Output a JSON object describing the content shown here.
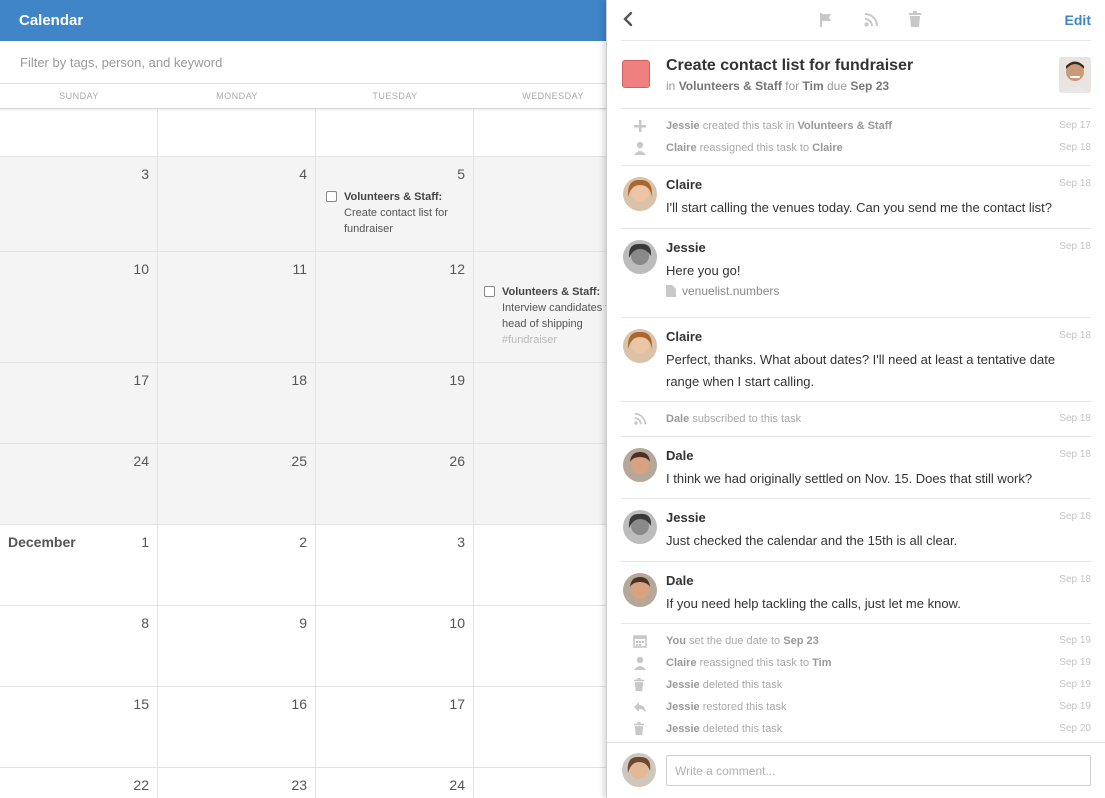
{
  "calendar": {
    "title": "Calendar",
    "filter_placeholder": "Filter by tags, person, and keyword",
    "weekdays": [
      "SUNDAY",
      "MONDAY",
      "TUESDAY",
      "WEDNESDAY"
    ],
    "weeks": [
      {
        "days": [
          "",
          "",
          "",
          ""
        ]
      },
      {
        "days": [
          "3",
          "4",
          "5",
          ""
        ]
      },
      {
        "days": [
          "10",
          "11",
          "12",
          ""
        ]
      },
      {
        "days": [
          "17",
          "18",
          "19",
          ""
        ]
      },
      {
        "days": [
          "24",
          "25",
          "26",
          ""
        ]
      },
      {
        "month": "December",
        "days": [
          "1",
          "2",
          "3",
          ""
        ]
      },
      {
        "days": [
          "8",
          "9",
          "10",
          ""
        ]
      },
      {
        "days": [
          "15",
          "16",
          "17",
          ""
        ]
      },
      {
        "days": [
          "22",
          "23",
          "24",
          ""
        ]
      }
    ],
    "tasks": {
      "t1": {
        "title": "Volunteers & Staff:",
        "text": "Create contact list for fundraiser"
      },
      "t2": {
        "title": "Volunteers & Staff:",
        "text": "Interview candidates for head of shipping",
        "tag": "#fundraiser"
      }
    }
  },
  "detail": {
    "edit_label": "Edit",
    "task_title": "Create contact list for fundraiser",
    "sub_in": "in",
    "sub_project": "Volunteers & Staff",
    "sub_for": "for",
    "sub_person": "Tim",
    "sub_due": "due",
    "sub_date": "Sep 23",
    "swatch_color": "#f08080",
    "accent_color": "#3f85c8",
    "feed": {
      "sys1": [
        {
          "icon": "plus-icon",
          "actor": "Jessie",
          "text": "created this task in",
          "obj": "Volunteers & Staff",
          "date": "Sep 17"
        },
        {
          "icon": "person-icon",
          "actor": "Claire",
          "text": "reassigned this task to",
          "obj": "Claire",
          "date": "Sep 18"
        }
      ],
      "c1": {
        "name": "Claire",
        "date": "Sep 18",
        "body": "I'll start calling the venues today. Can you send me the contact list?"
      },
      "c2": {
        "name": "Jessie",
        "date": "Sep 18",
        "body": "Here you go!",
        "attachment": "venuelist.numbers"
      },
      "c3": {
        "name": "Claire",
        "date": "Sep 18",
        "body": "Perfect, thanks. What about dates? I'll need at least a tentative date range when I start calling."
      },
      "sys2": [
        {
          "icon": "rss-icon",
          "actor": "Dale",
          "text": "subscribed to this task",
          "obj": "",
          "date": "Sep 18"
        }
      ],
      "c4": {
        "name": "Dale",
        "date": "Sep 18",
        "body": "I think we had originally settled on Nov. 15. Does that still work?"
      },
      "c5": {
        "name": "Jessie",
        "date": "Sep 18",
        "body": "Just checked the calendar and the 15th is all clear."
      },
      "c6": {
        "name": "Dale",
        "date": "Sep 18",
        "body": "If you need help tackling the calls, just let me know."
      },
      "sys3": [
        {
          "icon": "calendar-icon",
          "actor": "You",
          "text": "set the due date to",
          "obj": "Sep 23",
          "date": "Sep 19"
        },
        {
          "icon": "person-icon",
          "actor": "Claire",
          "text": "reassigned this task to",
          "obj": "Tim",
          "date": "Sep 19"
        },
        {
          "icon": "trash-icon",
          "actor": "Jessie",
          "text": "deleted this task",
          "obj": "",
          "date": "Sep 19"
        },
        {
          "icon": "restore-icon",
          "actor": "Jessie",
          "text": "restored this task",
          "obj": "",
          "date": "Sep 19"
        },
        {
          "icon": "trash-icon",
          "actor": "Jessie",
          "text": "deleted this task",
          "obj": "",
          "date": "Sep 20"
        }
      ]
    },
    "comment_placeholder": "Write a comment..."
  }
}
